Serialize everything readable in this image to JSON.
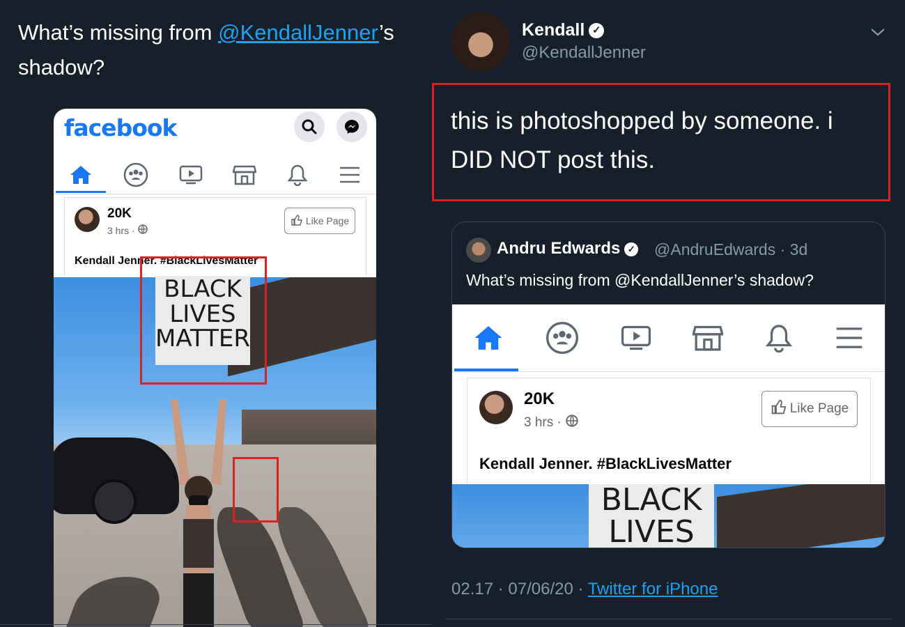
{
  "left_tweet": {
    "text_before": "What’s missing from ",
    "mention": "@KendallJenner",
    "text_after": "’s shadow?"
  },
  "fb_screenshot": {
    "logo": "facebook",
    "post": {
      "page_name": "20K",
      "time": "3 hrs ·",
      "like_button": "Like Page",
      "caption": "Kendall Jenner. #BlackLivesMatter"
    },
    "sign_lines": [
      "BLACK",
      "LIVES",
      "MATTER"
    ]
  },
  "right_tweet": {
    "author_name": "Kendall",
    "author_handle": "@KendallJenner",
    "text": "this is photoshopped by someone. i DID NOT post this.",
    "quote": {
      "name": "Andru Edwards",
      "meta": "@AndruEdwards · 3d",
      "text": "What’s missing from @KendallJenner’s shadow?",
      "post": {
        "page_name": "20K",
        "time": "3 hrs ·",
        "like_button": "Like Page",
        "caption": "Kendall Jenner. #BlackLivesMatter"
      },
      "sign_lines": [
        "BLACK",
        "LIVES"
      ]
    },
    "timestamp": "02.17 · 07/06/20 ·",
    "source": "Twitter for iPhone"
  },
  "colors": {
    "background": "#15202b",
    "accent": "#1da1f2",
    "fb_blue": "#1877f2",
    "highlight_red": "#e0201e",
    "muted": "#8899a6"
  },
  "icons": [
    "search-icon",
    "messenger-icon",
    "home-icon",
    "groups-icon",
    "watch-icon",
    "marketplace-icon",
    "bell-icon",
    "menu-icon",
    "verified-icon",
    "chevron-down-icon",
    "globe-icon",
    "thumbs-up-icon"
  ]
}
